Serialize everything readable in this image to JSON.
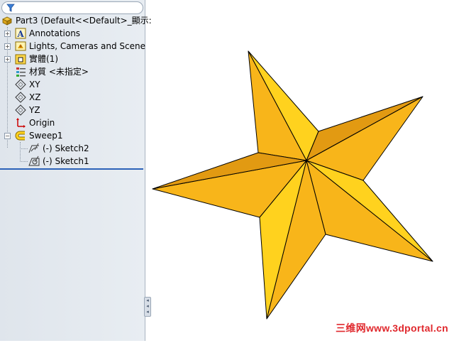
{
  "feature_tree": {
    "filter_icon": "filter-icon",
    "root": {
      "label": "Part3  (Default<<Default>_顯示:"
    },
    "items": [
      {
        "label": "Annotations",
        "icon": "annotations-icon",
        "expander": "+"
      },
      {
        "label": "Lights, Cameras and Scene",
        "icon": "lights-icon",
        "expander": "+"
      },
      {
        "label": "實體(1)",
        "icon": "solid-bodies-icon",
        "expander": "+"
      },
      {
        "label": "材質 <未指定>",
        "icon": "material-icon",
        "expander": ""
      },
      {
        "label": "XY",
        "icon": "plane-icon",
        "expander": ""
      },
      {
        "label": "XZ",
        "icon": "plane-icon",
        "expander": ""
      },
      {
        "label": "YZ",
        "icon": "plane-icon",
        "expander": ""
      },
      {
        "label": "Origin",
        "icon": "origin-icon",
        "expander": ""
      },
      {
        "label": "Sweep1",
        "icon": "sweep-icon",
        "expander": "−"
      },
      {
        "label": "(-) Sketch2",
        "icon": "sketch-icon",
        "expander": ""
      },
      {
        "label": "(-) Sketch1",
        "icon": "sketch-icon",
        "expander": ""
      }
    ]
  },
  "viewport": {
    "model": "star-model",
    "colors": {
      "face_light": "#FFD21E",
      "face_mid": "#F8B51A",
      "face_dark": "#E29A12",
      "edge": "#000000"
    }
  },
  "watermark": {
    "text": "三维网www.3dportal.cn",
    "color": "#e0282d"
  }
}
